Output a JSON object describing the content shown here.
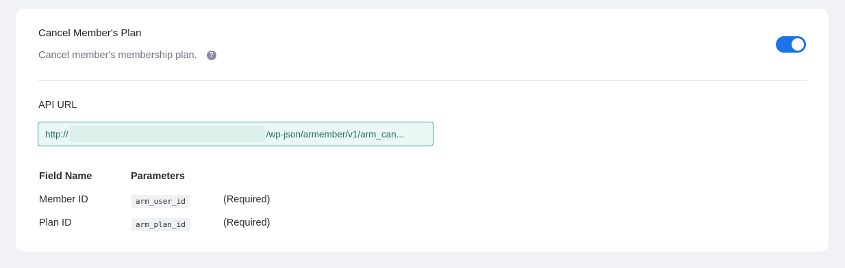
{
  "header": {
    "title": "Cancel Member's Plan",
    "description": "Cancel member's membership plan.",
    "help_icon": "?",
    "toggle_enabled": true
  },
  "api": {
    "label": "API URL",
    "url_prefix": "http://",
    "url_path": "/wp-json/armember/v1/arm_can..."
  },
  "params": {
    "headers": [
      "Field Name",
      "Parameters"
    ],
    "rows": [
      {
        "field": "Member ID",
        "param": "arm_user_id",
        "note": "(Required)"
      },
      {
        "field": "Plan ID",
        "param": "arm_plan_id",
        "note": "(Required)"
      }
    ]
  },
  "colors": {
    "toggle": "#1a73e8",
    "url_border": "#22a89a",
    "url_bg": "#eaf7f4"
  }
}
